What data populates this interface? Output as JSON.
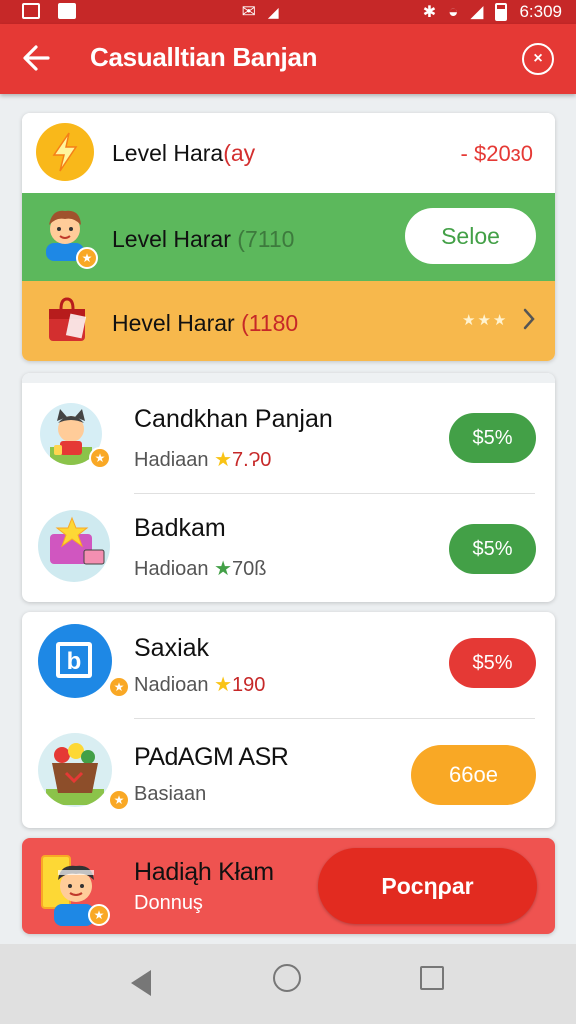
{
  "status_bar": {
    "time": "6:309"
  },
  "app_bar": {
    "title": "Casualltian Banjan",
    "close_symbol": "×"
  },
  "levels": {
    "row1": {
      "label": "Level Hara",
      "extra": "(ay",
      "value": "- $20ɜ0"
    },
    "row2": {
      "label": "Level Harar",
      "extra": "(7110",
      "button": "Seloe"
    },
    "row3": {
      "label": "Hevel Harar",
      "extra": "(1180",
      "stars": "★★★"
    }
  },
  "list1": [
    {
      "title": "Candkhan Panjan",
      "sub": "Hadiaan",
      "num": "7.Ɂ0",
      "star_color": "#f9c315",
      "badge": "$5%",
      "badge_color": "#43a047"
    },
    {
      "title": "Badkam",
      "sub": "Hadioan",
      "num": "70ß",
      "star_color": "#43a047",
      "badge": "$5%",
      "badge_color": "#43a047"
    }
  ],
  "list2": [
    {
      "title": "Saxiak",
      "sub": "Nadioan",
      "num": "190",
      "star_color": "#f9c315",
      "badge": "$5%",
      "badge_color": "#e53935"
    },
    {
      "title": "PAdAGM ASR",
      "sub": "Basiaan",
      "badge": "66oe",
      "badge_color": "#f9a825"
    }
  ],
  "bonus": {
    "title": "Hadiąh Kłam",
    "sub": "Donnuş",
    "button": "Pocηρar"
  },
  "colors": {
    "primary": "#e53935",
    "green": "#5cb85c",
    "orange": "#f7b84c",
    "bonus": "#ef5350"
  }
}
